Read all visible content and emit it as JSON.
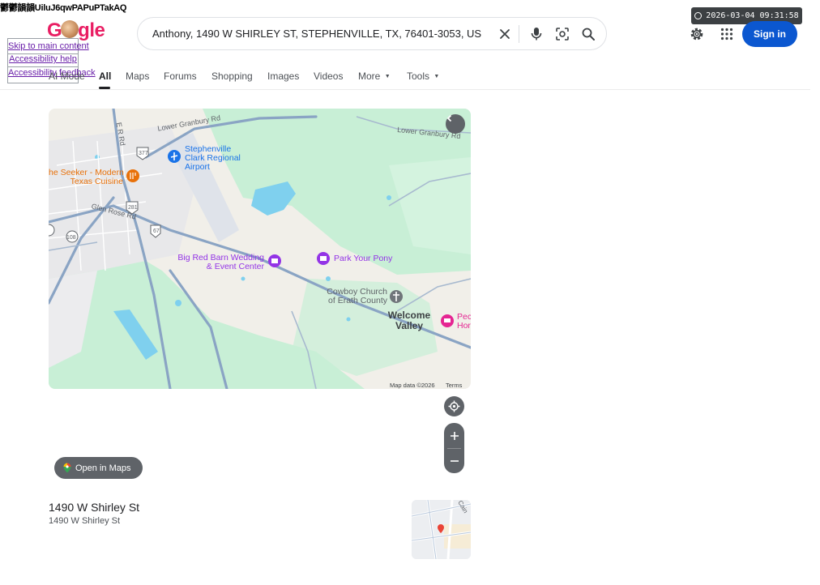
{
  "overlay": {
    "glitch_text": "鬱鬱韻韻UiluJ6qwPAPuPTakAQ",
    "skip_links": [
      "Skip to main content",
      "Accessibility help",
      "Accessibility feedback"
    ]
  },
  "header": {
    "logo_text_pre": "G",
    "logo_text_post": "gle",
    "search": {
      "value": "Anthony, 1490 W SHIRLEY ST, STEPHENVILLE, TX, 76401-3053, US",
      "placeholder": "Search"
    },
    "timestamp": "2026-03-04 09:31:58",
    "sign_in_label": "Sign in"
  },
  "tabs": {
    "items": [
      "AI Mode",
      "All",
      "Maps",
      "Forums",
      "Shopping",
      "Images",
      "Videos",
      "More",
      "Tools"
    ],
    "active": "All"
  },
  "map": {
    "labels": {
      "lower_granbury_1": "Lower Granbury Rd",
      "lower_granbury_2": "Lower Granbury Rd",
      "er_rd": "E R Rd",
      "airport": [
        "Stephenville",
        "Clark Regional",
        "Airport"
      ],
      "restaurant": [
        "he Seeker - Modern",
        "Texas Cuisine"
      ],
      "glen_rose": "Glen Rose Rd",
      "us377": "377",
      "us281": "281",
      "us67": "67",
      "tx108": "108",
      "big_red_barn": [
        "Big Red Barn Wedding",
        "& Event Center"
      ],
      "park_pony": "Park Your Pony",
      "cowboy_church": [
        "Cowboy Church",
        "of Erath County"
      ],
      "welcome_valley": [
        "Welcome",
        "Valley"
      ],
      "pecan": [
        "Pec",
        "Hor"
      ]
    },
    "footer_data": "Map data ©2026",
    "footer_terms": "Terms",
    "open_in_maps": "Open in Maps"
  },
  "place": {
    "title": "1490 W Shirley St",
    "subtitle": "1490 W Shirley St",
    "thumb_road": "Cain"
  },
  "colors": {
    "accent": "#0b57d0",
    "map_green": "#c8efd6",
    "map_land": "#f1efe9",
    "map_water": "#7fd0ee",
    "map_road": "#8aa4c4",
    "poi_purple": "#9334e6",
    "poi_orange": "#e8710a",
    "poi_pink": "#e52592"
  }
}
